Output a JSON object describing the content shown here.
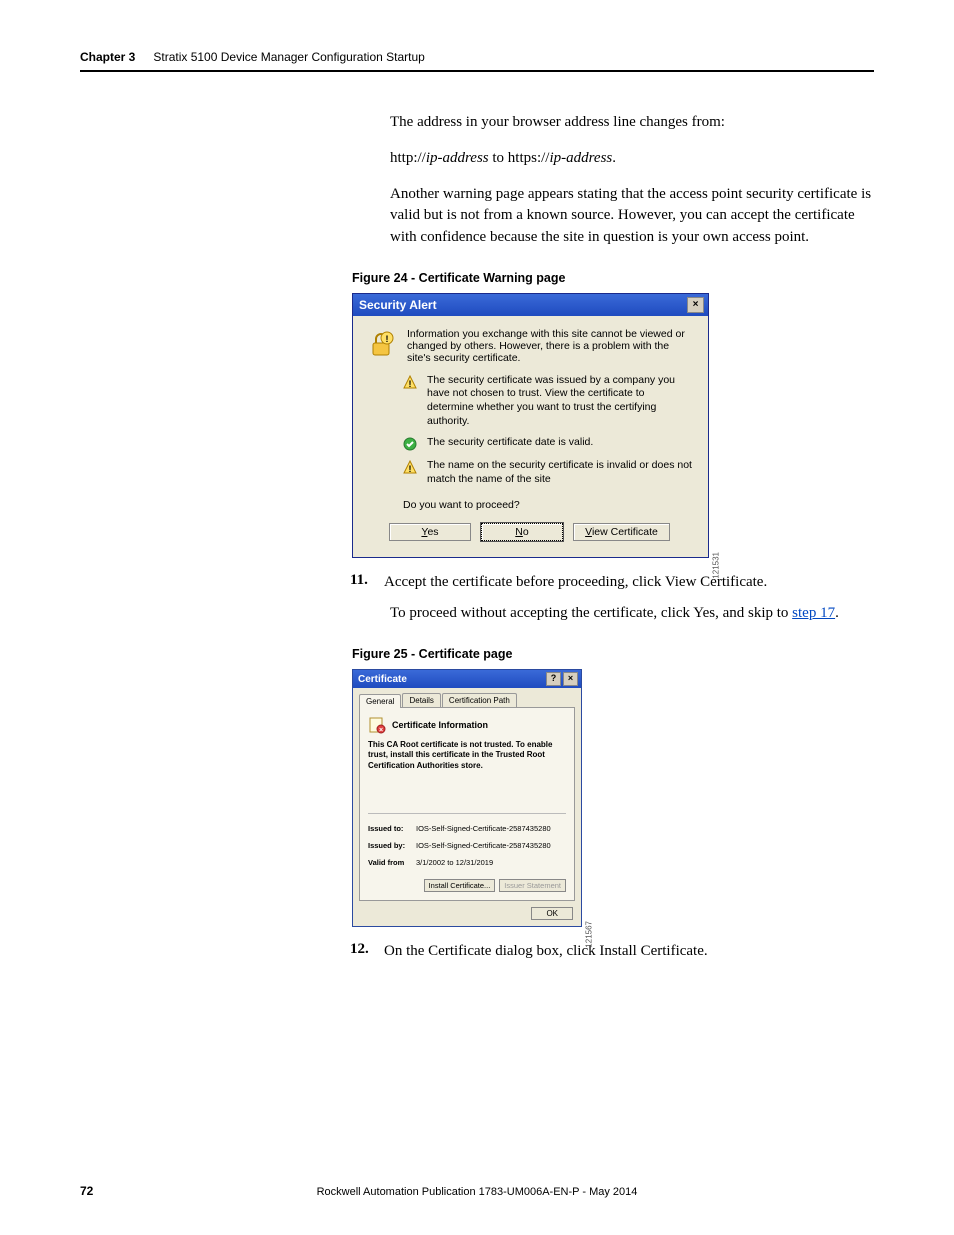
{
  "header": {
    "chapter": "Chapter 3",
    "title": "Stratix 5100 Device Manager Configuration Startup"
  },
  "para1": "The address in your browser address line changes from:",
  "para2_a": "http://",
  "para2_b": "ip-address",
  "para2_c": " to https://",
  "para2_d": "ip-address",
  "para2_e": ".",
  "para3": "Another warning page appears stating that the access point security certificate is valid but is not from a known source. However, you can accept the certificate with confidence because the site in question is your own access point.",
  "fig24": "Figure 24 - Certificate Warning page",
  "alert": {
    "title": "Security Alert",
    "main": "Information you exchange with this site cannot be viewed or changed by others. However, there is a problem with the site's security certificate.",
    "warn1": "The security certificate was issued by a company you have not chosen to trust. View the certificate to determine whether you want to trust the certifying authority.",
    "ok1": "The security certificate date is valid.",
    "warn2": "The name on the security certificate is invalid or does not match the name of the site",
    "question": "Do you want to proceed?",
    "yes": "es",
    "no": "o",
    "view": "iew Certificate",
    "side": "121531"
  },
  "step11": {
    "num": "11.",
    "text": "Accept the certificate before proceeding, click View Certificate.",
    "sub_a": "To proceed without accepting the certificate, click Yes, and skip to ",
    "sub_link": "step 17",
    "sub_b": "."
  },
  "fig25": "Figure 25 - Certificate page",
  "cert": {
    "title": "Certificate",
    "tab_general": "General",
    "tab_details": "Details",
    "tab_path": "Certification Path",
    "info_hdr": "Certificate Information",
    "warn": "This CA Root certificate is not trusted. To enable trust, install this certificate in the Trusted Root Certification Authorities store.",
    "issued_to_lbl": "Issued to:",
    "issued_to_val": "IOS-Self-Signed-Certificate-2587435280",
    "issued_by_lbl": "Issued by:",
    "issued_by_val": "IOS-Self-Signed-Certificate-2587435280",
    "valid_lbl": "Valid from",
    "valid_val": "3/1/2002 to 12/31/2019",
    "install": "Install Certificate...",
    "issuer_stmt": "Issuer Statement",
    "ok": "OK",
    "side": "121567"
  },
  "step12": {
    "num": "12.",
    "text": "On the Certificate dialog box, click Install Certificate."
  },
  "footer": "Rockwell Automation Publication 1783-UM006A-EN-P - May 2014",
  "page_num": "72"
}
